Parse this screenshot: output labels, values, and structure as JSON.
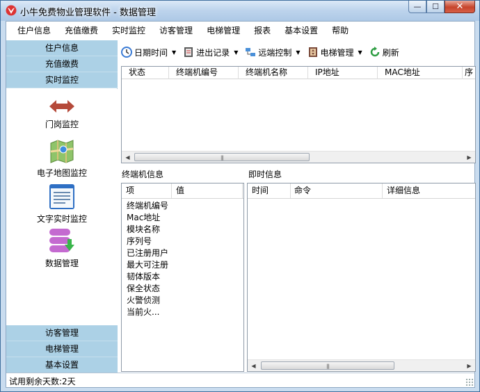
{
  "window": {
    "title": "小牛免费物业管理软件 - 数据管理",
    "controls": {
      "minimize": "—",
      "maximize": "☐",
      "close": "✕"
    }
  },
  "menu": [
    "住户信息",
    "充值缴费",
    "实时监控",
    "访客管理",
    "电梯管理",
    "报表",
    "基本设置",
    "帮助"
  ],
  "leftnav": {
    "top_groups": [
      "住户信息",
      "充值缴费",
      "实时监控"
    ],
    "tools": [
      {
        "label": "门岗监控",
        "icon": "double-arrow-icon"
      },
      {
        "label": "电子地图监控",
        "icon": "map-icon"
      },
      {
        "label": "文字实时监控",
        "icon": "document-window-icon"
      },
      {
        "label": "数据管理",
        "icon": "database-download-icon"
      }
    ],
    "bottom_groups": [
      "访客管理",
      "电梯管理",
      "基本设置"
    ]
  },
  "toolbar": {
    "items": [
      {
        "label": "日期时间",
        "icon": "clock-icon",
        "dropdown": true
      },
      {
        "label": "进出记录",
        "icon": "ledger-icon",
        "dropdown": true
      },
      {
        "label": "远端控制",
        "icon": "network-icon",
        "dropdown": true
      },
      {
        "label": "电梯管理",
        "icon": "elevator-icon",
        "dropdown": true
      },
      {
        "label": "刷新",
        "icon": "refresh-icon",
        "dropdown": false
      }
    ]
  },
  "terminal_table": {
    "columns": [
      "状态",
      "终端机编号",
      "终端机名称",
      "IP地址",
      "MAC地址",
      "序"
    ],
    "rows": []
  },
  "terminal_info": {
    "title": "终端机信息",
    "columns": [
      "项",
      "值"
    ],
    "items": [
      "终端机编号",
      "Mac地址",
      "模块名称",
      "序列号",
      "已注册用户",
      "最大可注册",
      "韧体版本",
      "保全状态",
      "火警侦测",
      "当前火..."
    ]
  },
  "instant_info": {
    "title": "即时信息",
    "columns": [
      "时间",
      "命令",
      "详细信息"
    ]
  },
  "status": {
    "text": "试用剩余天数:2天"
  },
  "colors": {
    "nav_group_bg": "#acd1e6",
    "titlebar": "#bcd3ec",
    "close_button": "#c6442b"
  }
}
